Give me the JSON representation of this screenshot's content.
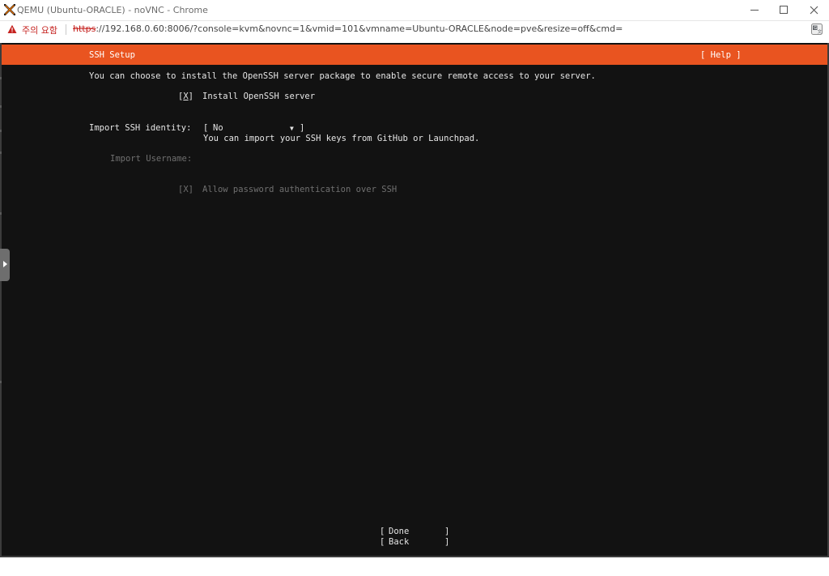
{
  "window": {
    "title": "QEMU (Ubuntu-ORACLE) - noVNC - Chrome",
    "icon": "proxmox-icon"
  },
  "address_bar": {
    "security_warning": "주의 요함",
    "url_scheme": "https",
    "url_rest": "://192.168.0.60:8006/?console=kvm&novnc=1&vmid=101&vmname=Ubuntu-ORACLE&node=pve&resize=off&cmd="
  },
  "installer": {
    "header": {
      "title": "SSH Setup",
      "help": "[ Help ]"
    },
    "intro": "You can choose to install the OpenSSH server package to enable secure remote access to your server.",
    "install_openssh": {
      "checkbox_open": "[",
      "checkbox_mark": "X",
      "checkbox_close": "]",
      "label": "Install OpenSSH server",
      "checked": true
    },
    "import_identity": {
      "label": "Import SSH identity:",
      "select_open": "[",
      "selected_value": "No",
      "arrow": "▼",
      "select_close": "]",
      "hint": "You can import your SSH keys from GitHub or Launchpad."
    },
    "import_username": {
      "label": "Import Username:",
      "value": ""
    },
    "allow_password": {
      "checkbox": "[X]",
      "label": "Allow password authentication over SSH",
      "checked": true
    },
    "buttons": {
      "done": "Done",
      "back": "Back",
      "bracket_open": "[",
      "bracket_close": "]"
    }
  },
  "colors": {
    "header_bg": "#e95420",
    "console_bg": "#121212",
    "text": "#e6e6e6",
    "disabled_text": "#707070",
    "warning_red": "#c5221f"
  }
}
